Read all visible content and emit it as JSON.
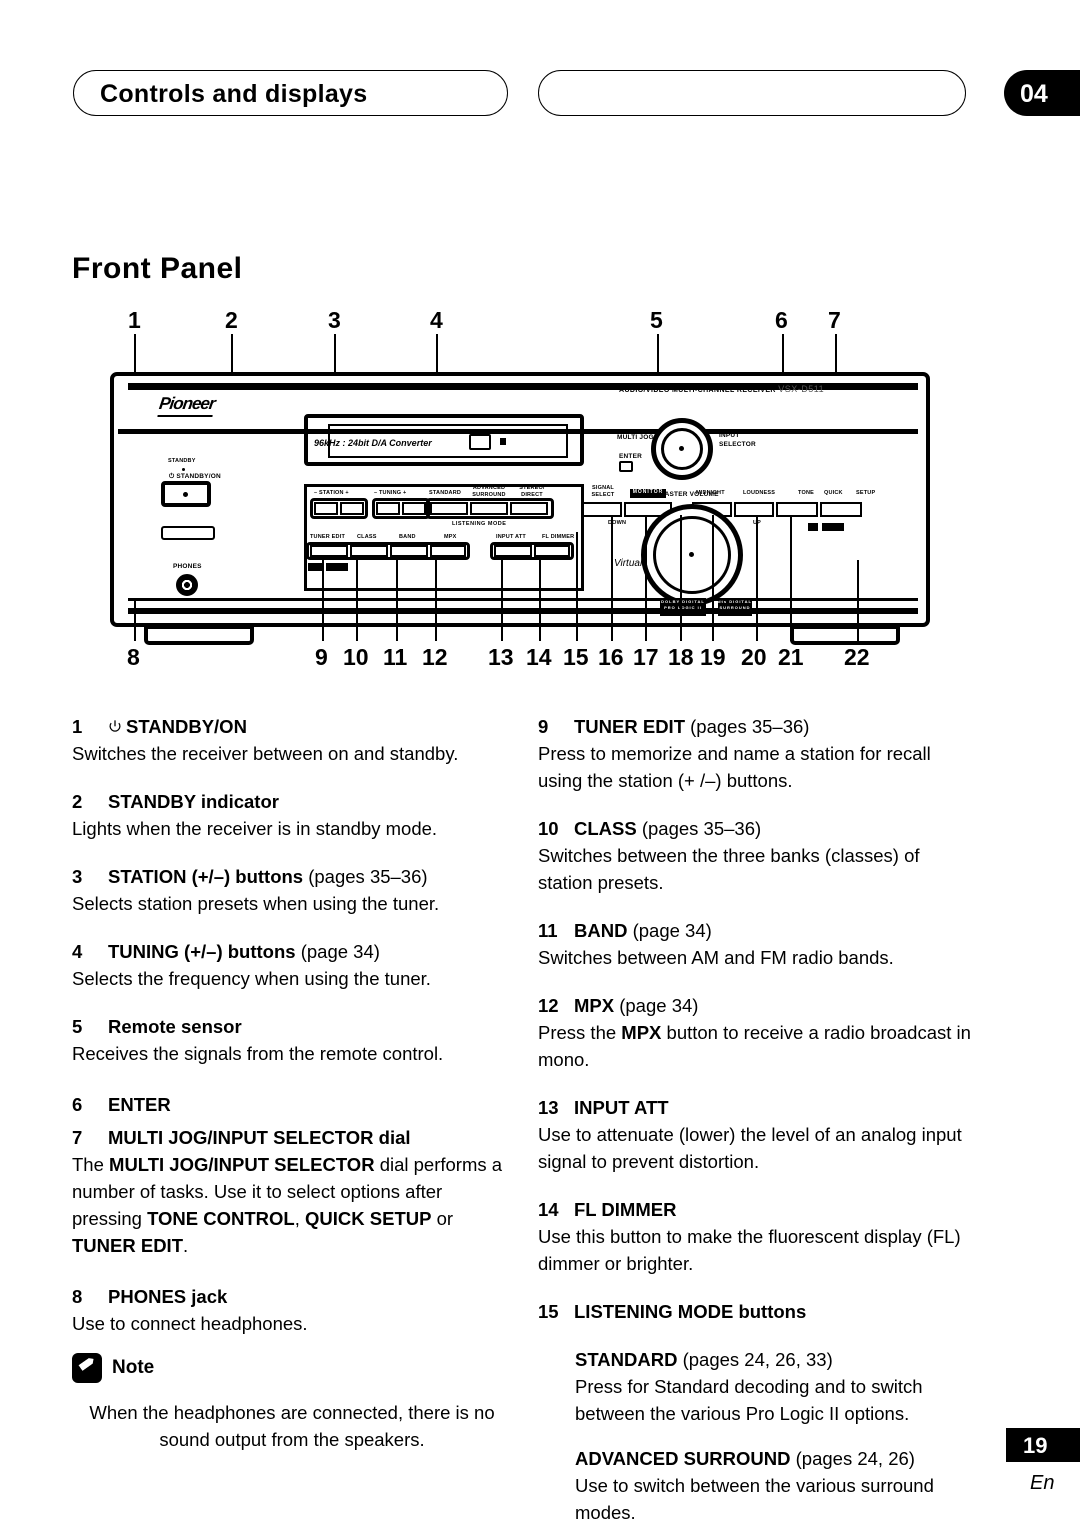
{
  "header": {
    "chapter_title": "Controls and displays",
    "chapter_number": "04"
  },
  "section": {
    "heading": "Front Panel"
  },
  "figure": {
    "callouts_top": [
      "1",
      "2",
      "3",
      "4",
      "5",
      "6",
      "7"
    ],
    "callouts_bottom": [
      "8",
      "9",
      "10",
      "11",
      "12",
      "13",
      "14",
      "15",
      "16",
      "17",
      "18",
      "19",
      "20",
      "21",
      "22"
    ],
    "brand": "Pioneer",
    "model_line": "AUDIO/VIDEO MULTI-CHANNEL RECEIVER",
    "model_name": "VSX-D511",
    "dac_text": "96kHz : 24bit D/A Converter",
    "standby_label": "STANDBY",
    "standby_on_label": "STANDBY/ON",
    "phones_label": "PHONES",
    "multi_jog_label": "MULTI JOG",
    "enter_label": "ENTER",
    "input_selector_label": "INPUT\nSELECTOR",
    "master_volume_label": "MASTER VOLUME",
    "down_label": "DOWN",
    "up_label": "UP",
    "virtual_text": "Virtual Surround Back",
    "listening_mode_label": "LISTENING MODE",
    "button_labels_row1": [
      "– STATION +",
      "– TUNING +",
      "STANDARD",
      "ADVANCED SURROUND",
      "STEREO/ DIRECT",
      "SIGNAL SELECT",
      "MONITOR",
      "MIDNIGHT",
      "LOUDNESS",
      "TONE",
      "QUICK",
      "SETUP"
    ],
    "button_labels_row2": [
      "TUNER EDIT",
      "CLASS",
      "BAND",
      "MPX",
      "INPUT ATT",
      "FL DIMMER"
    ],
    "logo_dolby": "DOLBY DIGITAL PRO LOGIC II",
    "logo_dts": "dts DIGITAL SURROUND"
  },
  "items_left": [
    {
      "num": "1",
      "title": "STANDBY/ON",
      "has_power_icon": true,
      "pages": "",
      "body": "Switches the receiver between on and standby."
    },
    {
      "num": "2",
      "title": "STANDBY indicator",
      "has_power_icon": false,
      "pages": "",
      "body": "Lights when the receiver is in standby mode."
    },
    {
      "num": "3",
      "title": "STATION (+/–) buttons",
      "has_power_icon": false,
      "pages": "(pages 35–36)",
      "body": "Selects station presets when using the tuner."
    },
    {
      "num": "4",
      "title": "TUNING (+/–) buttons",
      "has_power_icon": false,
      "pages": "(page 34)",
      "body": "Selects the frequency when using the tuner."
    },
    {
      "num": "5",
      "title": "Remote sensor",
      "has_power_icon": false,
      "pages": "",
      "body": "Receives the signals from the remote control."
    },
    {
      "num": "6",
      "title": "ENTER",
      "has_power_icon": false,
      "pages": "",
      "body": ""
    },
    {
      "num": "7",
      "title": "MULTI JOG/INPUT SELECTOR dial",
      "has_power_icon": false,
      "pages": "",
      "body": "The MULTI JOG/INPUT SELECTOR dial performs a number of tasks. Use it to select options after pressing TONE CONTROL, QUICK SETUP or TUNER EDIT."
    },
    {
      "num": "8",
      "title": "PHONES jack",
      "has_power_icon": false,
      "pages": "",
      "body": "Use to connect headphones."
    }
  ],
  "note": {
    "label": "Note",
    "text": "When the headphones are connected, there is no sound output from the speakers."
  },
  "items_right": [
    {
      "num": "9",
      "title": "TUNER EDIT",
      "pages": "(pages 35–36)",
      "body": "Press to memorize and name a station for recall using the station (+ /–) buttons."
    },
    {
      "num": "10",
      "title": "CLASS",
      "pages": "(pages 35–36)",
      "body": "Switches between the three banks (classes) of station presets."
    },
    {
      "num": "11",
      "title": "BAND",
      "pages": "(page 34)",
      "body": "Switches between AM and FM radio bands."
    },
    {
      "num": "12",
      "title": "MPX",
      "pages": "(page 34)",
      "body": "Press the MPX button to receive a radio broadcast in mono."
    },
    {
      "num": "13",
      "title": "INPUT ATT",
      "pages": "",
      "body": "Use to attenuate (lower) the level of an analog input signal to prevent distortion."
    },
    {
      "num": "14",
      "title": "FL DIMMER",
      "pages": "",
      "body": "Use this button to make the fluorescent display (FL) dimmer or brighter."
    },
    {
      "num": "15",
      "title": "LISTENING MODE buttons",
      "pages": "",
      "body": ""
    }
  ],
  "sub_items_right": [
    {
      "title": "STANDARD",
      "pages": "(pages 24, 26, 33)",
      "body": "Press for Standard decoding and to switch between the various Pro Logic II options."
    },
    {
      "title": "ADVANCED SURROUND",
      "pages": "(pages 24, 26)",
      "body": "Use to switch between the various surround modes."
    }
  ],
  "footer": {
    "page_number": "19",
    "language": "En"
  }
}
